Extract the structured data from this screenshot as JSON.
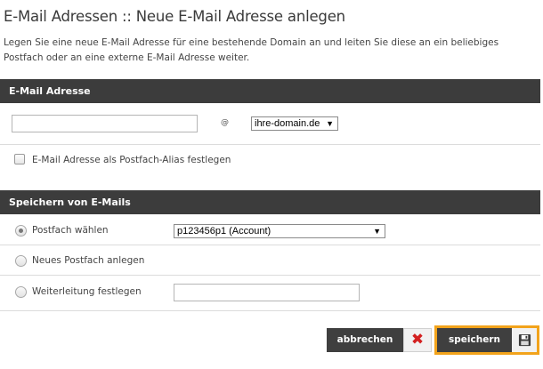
{
  "page": {
    "title": "E-Mail Adressen :: Neue E-Mail Adresse anlegen",
    "intro": "Legen Sie eine neue E-Mail Adresse für eine bestehende Domain an und leiten Sie diese an ein beliebiges Postfach oder an eine externe E-Mail Adresse weiter."
  },
  "email_section": {
    "header": "E-Mail Adresse",
    "address_value": "",
    "at_sign": "@",
    "domain_selected": "ihre-domain.de",
    "alias_label": "E-Mail Adresse als Postfach-Alias festlegen",
    "alias_checked": false
  },
  "storage_section": {
    "header": "Speichern von E-Mails",
    "options": [
      {
        "label": "Postfach wählen",
        "checked": true
      },
      {
        "label": "Neues Postfach anlegen",
        "checked": false
      },
      {
        "label": "Weiterleitung festlegen",
        "checked": false
      }
    ],
    "mailbox_selected": "p123456p1 (Account)",
    "forward_value": ""
  },
  "actions": {
    "cancel_label": "abbrechen",
    "save_label": "speichern"
  },
  "icons": {
    "cancel": "close-icon",
    "save": "floppy-disk-icon",
    "select": "chevron-down-icon"
  },
  "colors": {
    "header_bg": "#3c3c3c",
    "highlight": "#f2a31b",
    "cancel_icon": "#d32020"
  }
}
